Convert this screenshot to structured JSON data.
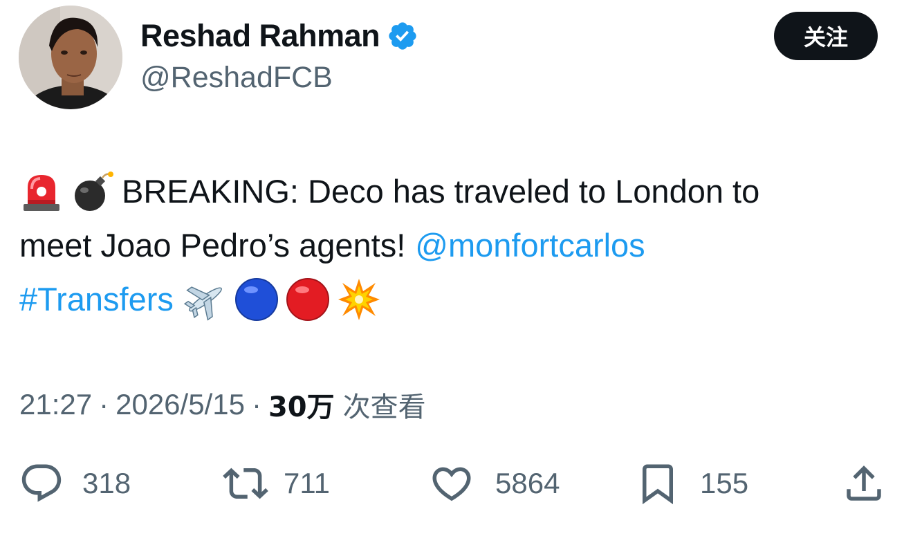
{
  "author": {
    "display_name": "Reshad Rahman",
    "handle": "@ReshadFCB",
    "verified": true
  },
  "follow_button_label": "关注",
  "tweet": {
    "line1_text": "BREAKING: Deco has traveled to London to",
    "line2_text": "meet Joao Pedro’s agents!",
    "mention": "@monfortcarlos",
    "hashtag": "#Transfers",
    "emojis_prefix": [
      "police-light",
      "bomb"
    ],
    "emojis_suffix": [
      "airplane",
      "blue-circle",
      "red-circle",
      "collision"
    ]
  },
  "meta": {
    "time": "21:27",
    "date": "2026/5/15",
    "separator": "·",
    "views_count": "30万",
    "views_label": "次查看"
  },
  "actions": {
    "replies": "318",
    "retweets": "711",
    "likes": "5864",
    "bookmarks": "155"
  },
  "colors": {
    "link": "#1d9bf0",
    "secondary_text": "#536471",
    "primary_text": "#0f1419",
    "verified_badge": "#1d9bf0"
  }
}
